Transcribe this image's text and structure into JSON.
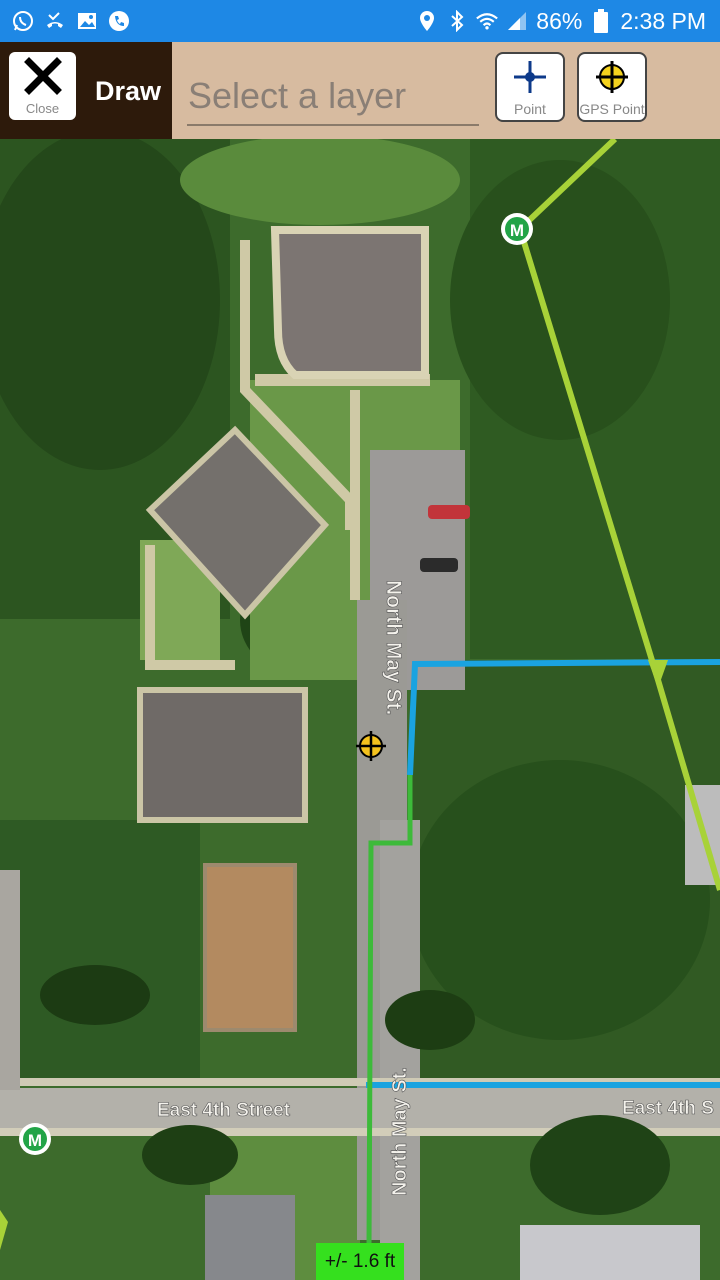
{
  "status_bar": {
    "battery": "86%",
    "time": "2:38 PM",
    "icons": [
      "whatsapp-icon",
      "missed-call-icon",
      "gallery-icon",
      "phone-icon",
      "location-icon",
      "bluetooth-icon",
      "wifi-icon",
      "signal-icon",
      "battery-icon"
    ]
  },
  "toolbar": {
    "close_label": "Close",
    "title": "Draw",
    "layer_placeholder": "Select a layer",
    "point_label": "Point",
    "gps_point_label": "GPS Point"
  },
  "map": {
    "street_labels": {
      "north_may_upper": "North May St.",
      "north_may_lower": "North May St.",
      "east_4th_left": "East 4th Street",
      "east_4th_right": "East 4th S"
    },
    "marker_labels": {
      "m_upper": "M",
      "m_left": "M"
    },
    "colors": {
      "blue_line": "#1aa3e0",
      "green_line": "#3dba3a",
      "yellow_green_line": "#a8d238",
      "status_bar": "#1e88e5",
      "toolbar_bg": "#d7bba0",
      "toolbar_left_bg": "#2d1a0b"
    }
  },
  "accuracy": {
    "text": "+/- 1.6 ft"
  }
}
